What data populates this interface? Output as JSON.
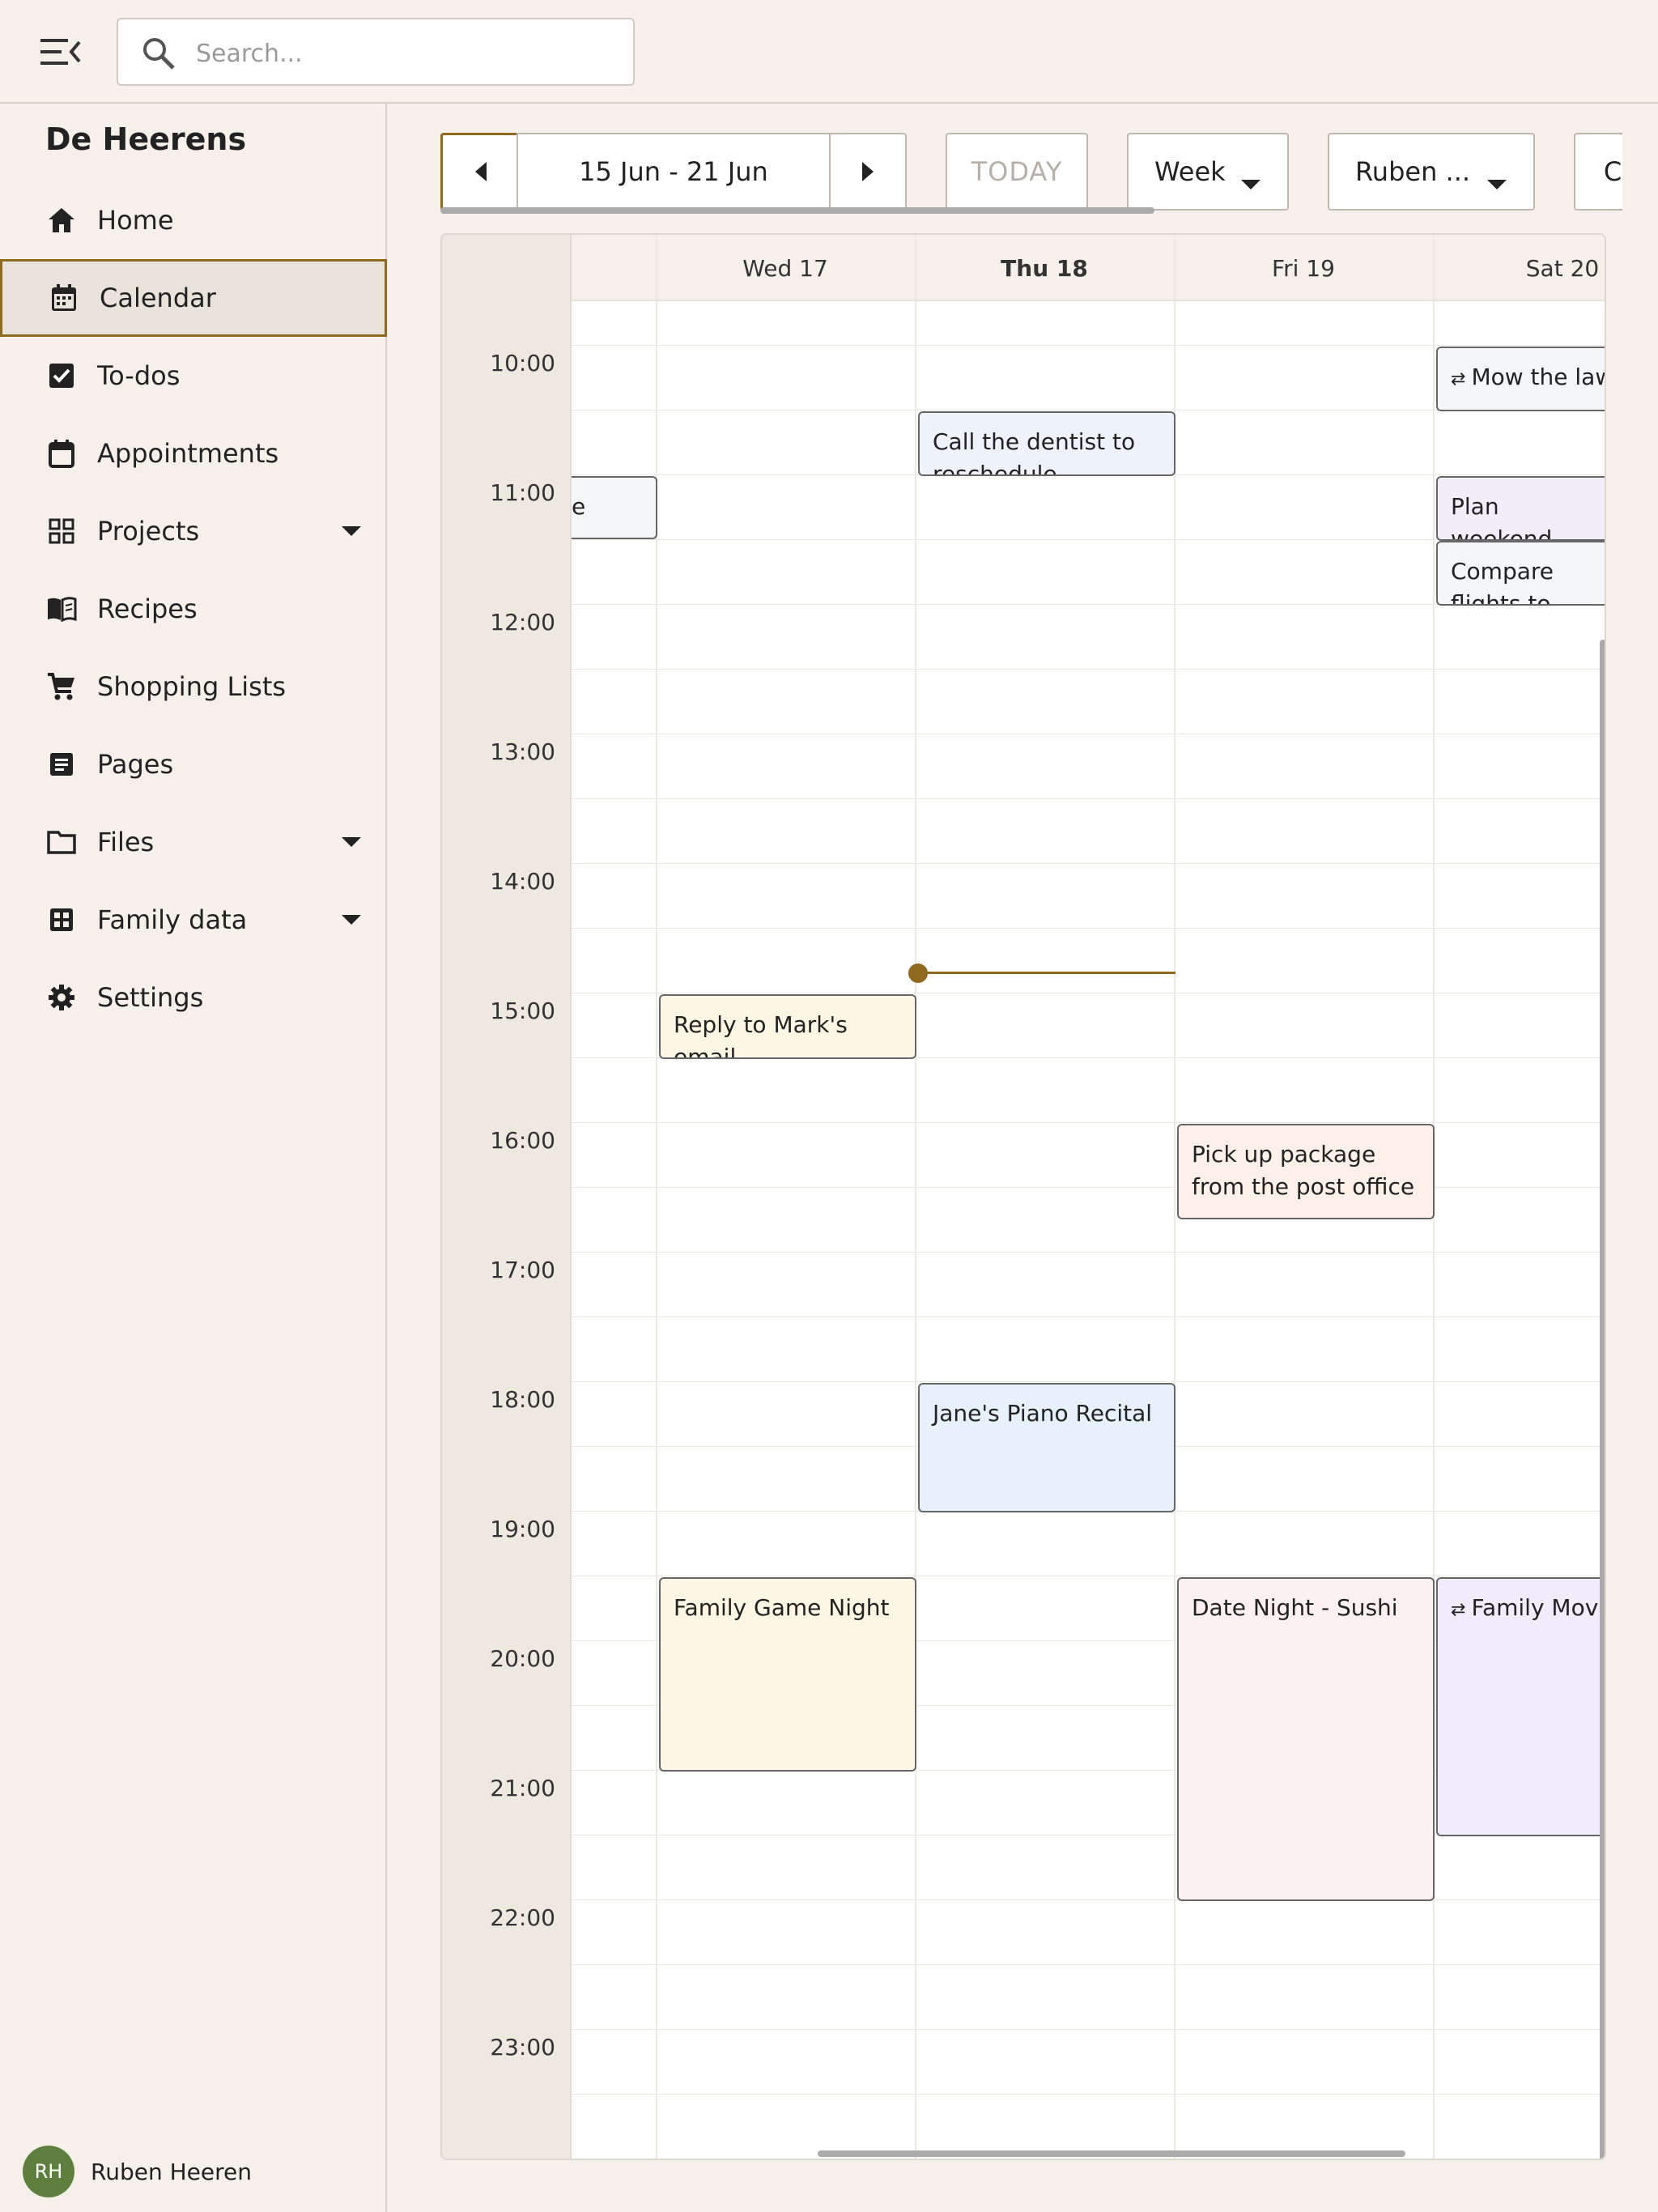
{
  "search": {
    "placeholder": "Search..."
  },
  "sidebar": {
    "family_name": "De Heerens",
    "items": [
      {
        "label": "Home",
        "icon": "home-icon"
      },
      {
        "label": "Calendar",
        "icon": "calendar-icon",
        "active": true
      },
      {
        "label": "To-dos",
        "icon": "checkbox-icon"
      },
      {
        "label": "Appointments",
        "icon": "appointment-icon"
      },
      {
        "label": "Projects",
        "icon": "grid-icon",
        "expandable": true
      },
      {
        "label": "Recipes",
        "icon": "book-icon"
      },
      {
        "label": "Shopping Lists",
        "icon": "cart-icon"
      },
      {
        "label": "Pages",
        "icon": "page-icon"
      },
      {
        "label": "Files",
        "icon": "folder-icon",
        "expandable": true
      },
      {
        "label": "Family data",
        "icon": "table-icon",
        "expandable": true
      },
      {
        "label": "Settings",
        "icon": "gear-icon"
      }
    ]
  },
  "user": {
    "initials": "RH",
    "name": "Ruben Heeren",
    "avatar_color": "#5f7f3f"
  },
  "toolbar": {
    "date_range": "15 Jun - 21 Jun",
    "today_label": "TODAY",
    "view_label": "Week",
    "person_label": "Ruben ...",
    "extra_label": "C"
  },
  "calendar": {
    "days": [
      "",
      "Wed 17",
      "Thu 18",
      "Fri 19",
      "Sat 20"
    ],
    "today_day": "Thu 18",
    "hours": [
      "10:00",
      "11:00",
      "12:00",
      "13:00",
      "14:00",
      "15:00",
      "16:00",
      "17:00",
      "18:00",
      "19:00",
      "20:00",
      "21:00",
      "22:00",
      "23:00"
    ],
    "events": [
      {
        "title": "e",
        "day": 0,
        "color": "grey"
      },
      {
        "title": "Call the dentist to reschedule",
        "day": 2,
        "color": "blue"
      },
      {
        "title": "Mow the lawn",
        "day": 4,
        "recurring": true,
        "color": "grey"
      },
      {
        "title": "Plan weekend getaway",
        "day": 4,
        "color": "purple"
      },
      {
        "title": "Compare flights to Spain",
        "day": 4,
        "color": "grey"
      },
      {
        "title": "Reply to Mark's email",
        "day": 1,
        "color": "yellow"
      },
      {
        "title": "Pick up package from the post office",
        "day": 3,
        "color": "peach"
      },
      {
        "title": "Jane's Piano Recital",
        "day": 2,
        "color": "lightblue"
      },
      {
        "title": "Family Game Night",
        "day": 1,
        "color": "yellow"
      },
      {
        "title": "Date Night - Sushi",
        "day": 3,
        "color": "pink"
      },
      {
        "title": "Family Movie",
        "day": 4,
        "recurring": true,
        "color": "lavender"
      }
    ]
  },
  "colors": {
    "accent": "#8f6a1e",
    "background": "#f5f1ea"
  }
}
